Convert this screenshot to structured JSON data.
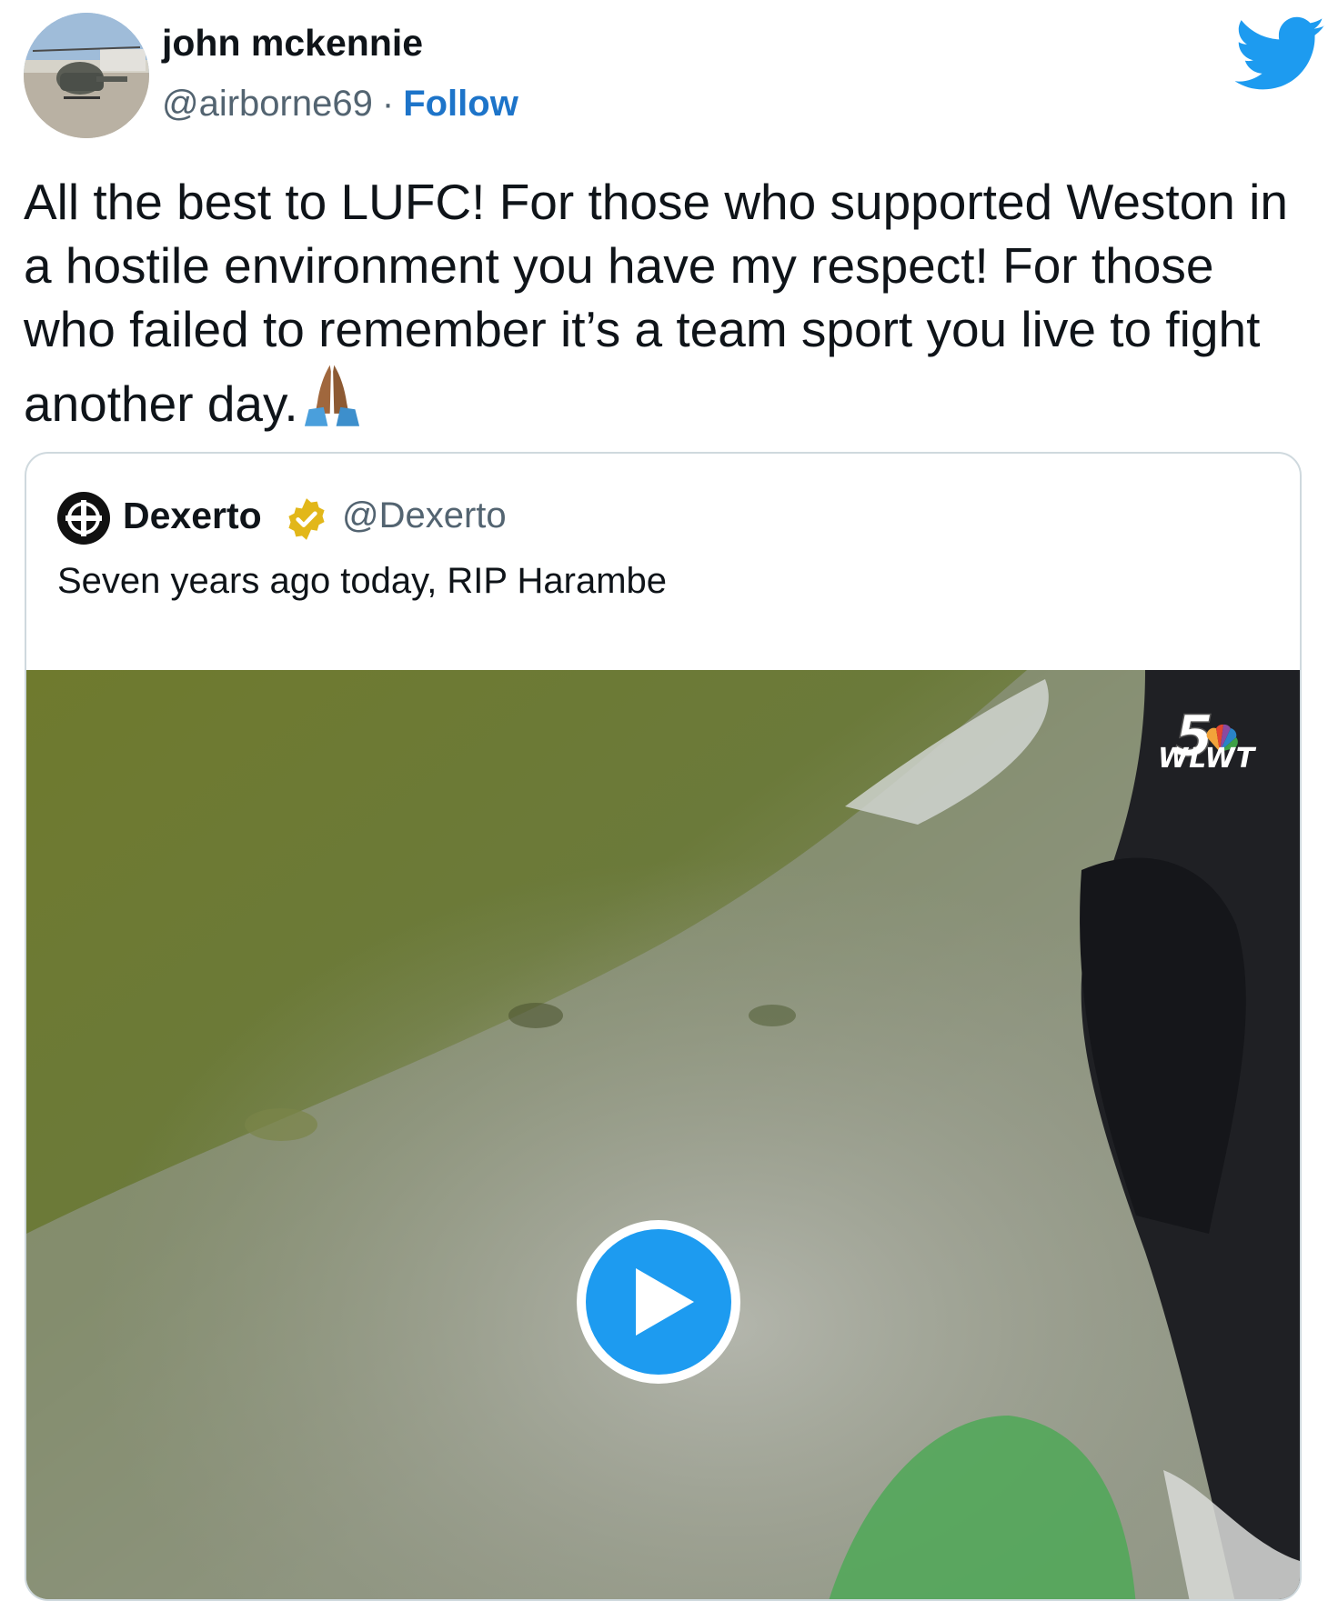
{
  "author": {
    "name": "john mckennie",
    "handle": "@airborne69",
    "separator": "·",
    "follow_label": "Follow",
    "avatar_icon": "helicopter-photo"
  },
  "brand_icon": "twitter-bird-icon",
  "tweet": {
    "text": "All the best to LUFC! For those who supported Weston in a hostile environment you have my respect! For those who failed to remember it’s a team sport you live to fight another day.",
    "emoji": "🙏🏾"
  },
  "quoted_tweet": {
    "author_name": "Dexerto",
    "author_handle": "@Dexerto",
    "verified": true,
    "text": "Seven years ago today, RIP Harambe",
    "media": {
      "type": "video",
      "watermark_number": "5",
      "watermark_text": "WLWT",
      "play_icon": "play-icon"
    }
  },
  "colors": {
    "accent": "#1d9bf0",
    "follow_link": "#1d74c9",
    "muted_text": "#536471",
    "verified_badge": "#e2b719"
  }
}
